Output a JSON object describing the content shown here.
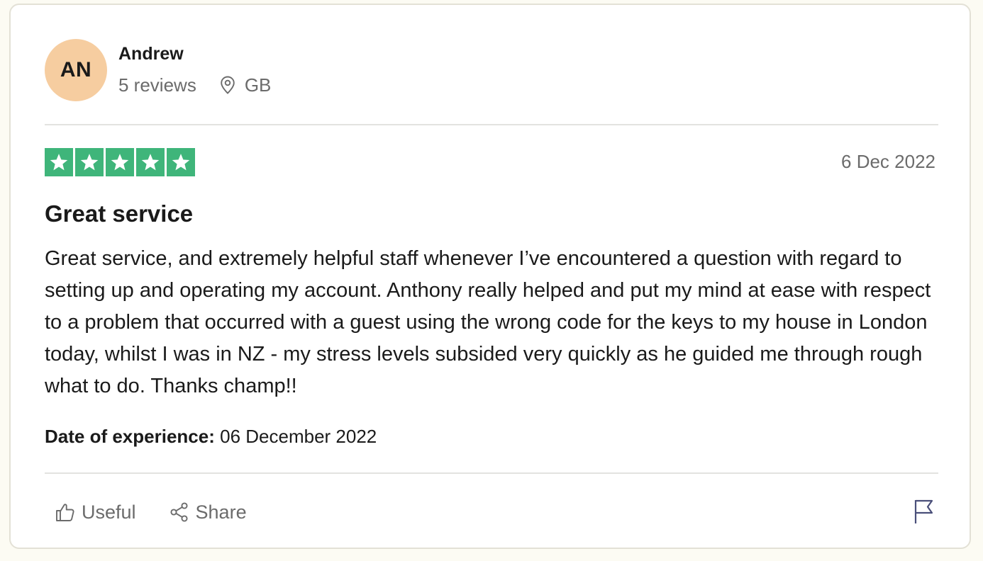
{
  "reviewer": {
    "initials": "AN",
    "name": "Andrew",
    "reviews_count": "5 reviews",
    "country": "GB",
    "avatar_color": "#f6cda0"
  },
  "rating": {
    "stars": 5,
    "max_stars": 5,
    "star_color": "#3fb57a",
    "star_icon": "star-icon"
  },
  "review": {
    "date": "6 Dec 2022",
    "title": "Great service",
    "text": "Great service, and extremely helpful staff whenever I’ve encountered a question with regard to setting up and operating my account. Anthony really helped and put my mind at ease with respect to a problem that occurred with a guest using the wrong code for the keys to my house in London today, whilst I was in NZ - my stress levels subsided very quickly as he guided me through rough what to do. Thanks champ!!",
    "experience_label": "Date of experience:",
    "experience_date": "06 December 2022"
  },
  "actions": {
    "useful_label": "Useful",
    "useful_icon": "thumbs-up-icon",
    "share_label": "Share",
    "share_icon": "share-icon",
    "report_icon": "flag-icon"
  }
}
